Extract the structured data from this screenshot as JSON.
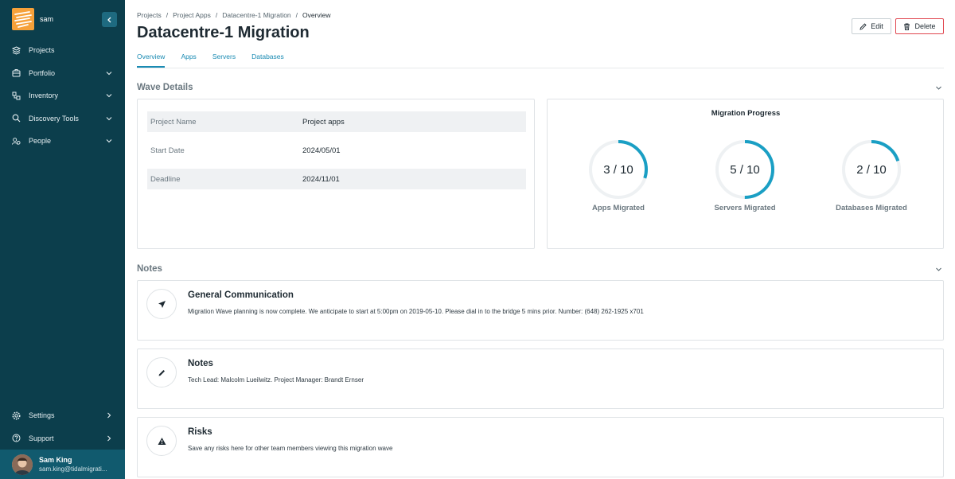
{
  "sidebar": {
    "brand_name": "sam",
    "items": [
      {
        "label": "Projects",
        "icon": "layers-icon"
      },
      {
        "label": "Portfolio",
        "icon": "briefcase-icon"
      },
      {
        "label": "Inventory",
        "icon": "inventory-icon"
      },
      {
        "label": "Discovery Tools",
        "icon": "search-icon"
      },
      {
        "label": "People",
        "icon": "people-icon"
      }
    ],
    "bottom_items": [
      {
        "label": "Settings",
        "icon": "gear-icon"
      },
      {
        "label": "Support",
        "icon": "help-icon"
      }
    ],
    "user": {
      "name": "Sam King",
      "email": "sam.king@tidalmigrati..."
    }
  },
  "breadcrumb": [
    "Projects",
    "Project Apps",
    "Datacentre-1 Migration",
    "Overview"
  ],
  "page_title": "Datacentre-1 Migration",
  "actions": {
    "edit_label": "Edit",
    "delete_label": "Delete"
  },
  "tabs": [
    "Overview",
    "Apps",
    "Servers",
    "Databases"
  ],
  "wave_details": {
    "title": "Wave Details",
    "rows": [
      {
        "label": "Project Name",
        "value": "Project apps"
      },
      {
        "label": "Start Date",
        "value": "2024/05/01"
      },
      {
        "label": "Deadline",
        "value": "2024/11/01"
      }
    ]
  },
  "migration_progress": {
    "title": "Migration Progress",
    "accent": "#1a9fc4",
    "track": "#eef1f3",
    "items": [
      {
        "label": "Apps Migrated",
        "value": "3 / 10",
        "done": 3,
        "total": 10
      },
      {
        "label": "Servers Migrated",
        "value": "5 / 10",
        "done": 5,
        "total": 10
      },
      {
        "label": "Databases Migrated",
        "value": "2 / 10",
        "done": 2,
        "total": 10
      }
    ]
  },
  "notes": {
    "title": "Notes",
    "items": [
      {
        "title": "General Communication",
        "body": "Migration Wave planning is now complete. We anticipate to start at 5:00pm on 2019-05-10. Please dial in to the bridge 5 mins prior. Number: (648) 262-1925 x701",
        "icon": "send-icon"
      },
      {
        "title": "Notes",
        "body": "Tech Lead: Malcolm Lueilwitz. Project Manager: Brandt Ernser",
        "icon": "pencil-icon"
      },
      {
        "title": "Risks",
        "body": "Save any risks here for other team members viewing this migration wave",
        "icon": "warning-icon"
      }
    ]
  }
}
